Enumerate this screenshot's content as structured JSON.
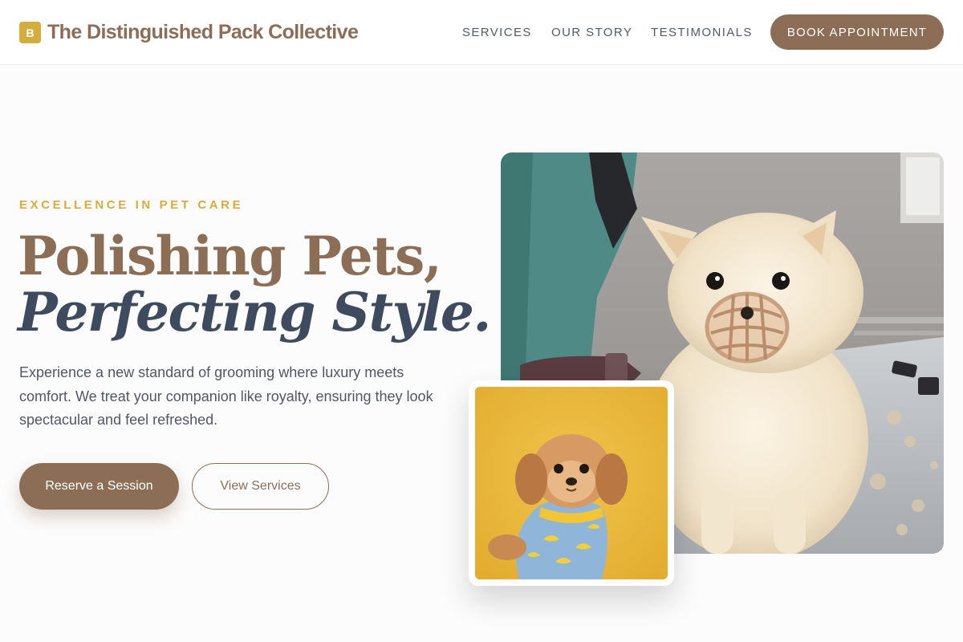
{
  "header": {
    "logo_letter": "B",
    "brand": "The Distinguished Pack Collective",
    "nav": [
      {
        "label": "SERVICES"
      },
      {
        "label": "OUR STORY"
      },
      {
        "label": "TESTIMONIALS"
      }
    ],
    "cta_label": "BOOK APPOINTMENT"
  },
  "hero": {
    "eyebrow": "EXCELLENCE IN PET CARE",
    "headline_line1": "Polishing Pets,",
    "headline_line2": "Perfecting Style.",
    "lead": "Experience a new standard of grooming where luxury meets comfort. We treat your companion like royalty, ensuring they look spectacular and feel refreshed.",
    "primary_button": "Reserve a Session",
    "secondary_button": "View Services"
  },
  "colors": {
    "brand_brown": "#8c6e57",
    "gold": "#d4ad3f",
    "navy": "#3e4a5e",
    "background": "#fcfcfc"
  }
}
